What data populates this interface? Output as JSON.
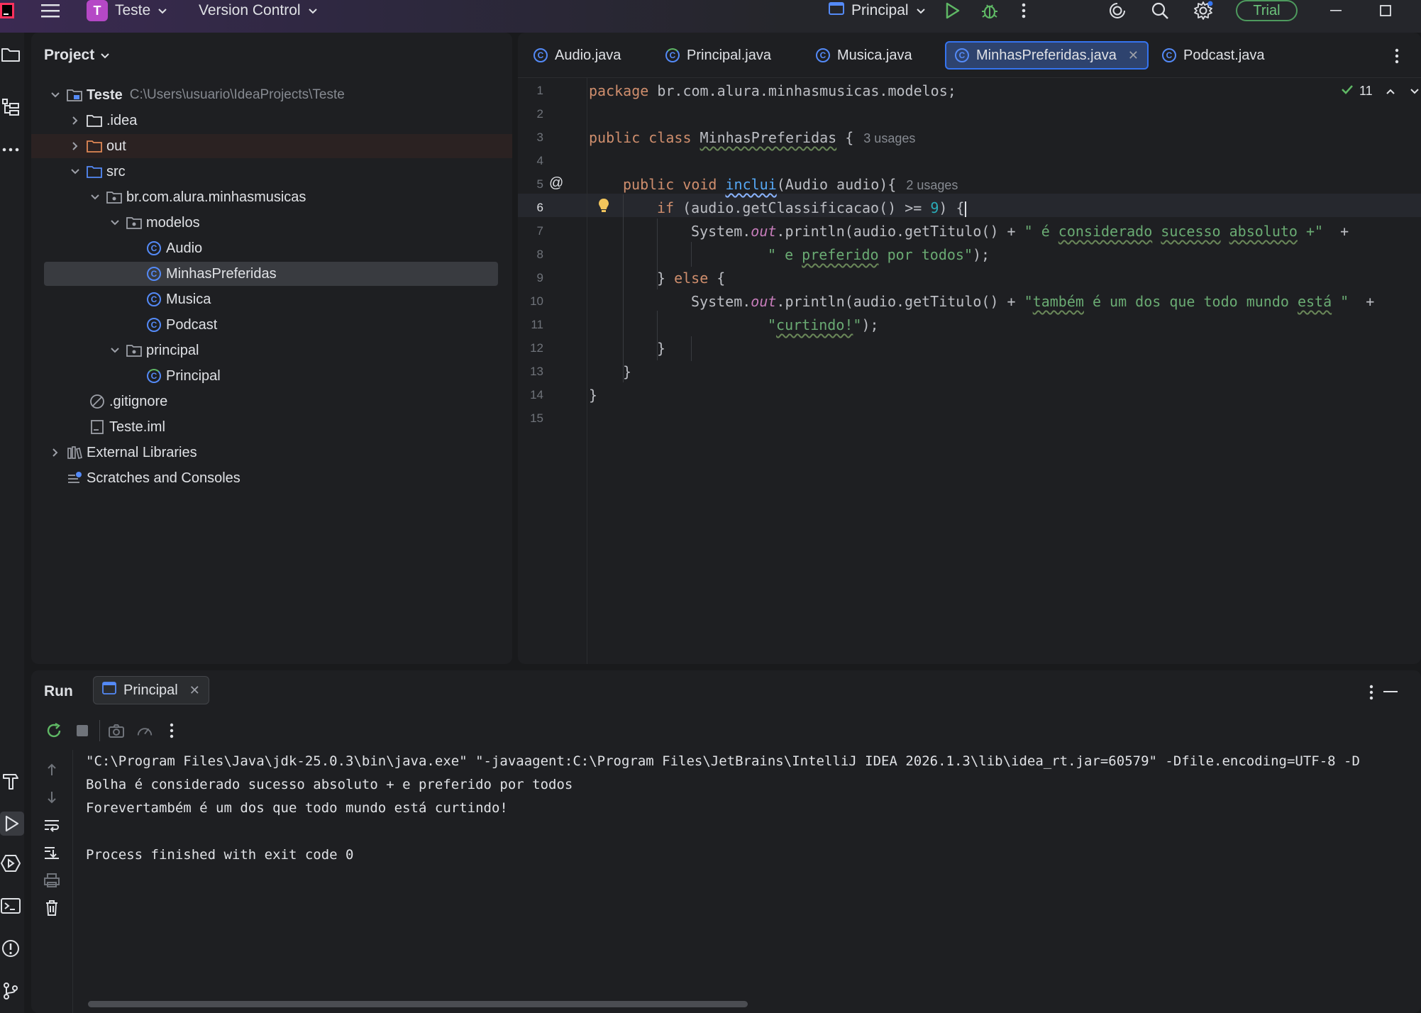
{
  "titlebar": {
    "project_badge": "T",
    "project_name": "Teste",
    "version_control": "Version Control",
    "run_config": "Principal",
    "trial": "Trial"
  },
  "project_panel": {
    "title": "Project",
    "tree": [
      {
        "label": "Teste",
        "path": "C:\\Users\\usuario\\IdeaProjects\\Teste"
      },
      {
        "label": ".idea"
      },
      {
        "label": "out"
      },
      {
        "label": "src"
      },
      {
        "label": "br.com.alura.minhasmusicas"
      },
      {
        "label": "modelos"
      },
      {
        "label": "Audio"
      },
      {
        "label": "MinhasPreferidas"
      },
      {
        "label": "Musica"
      },
      {
        "label": "Podcast"
      },
      {
        "label": "principal"
      },
      {
        "label": "Principal"
      },
      {
        "label": ".gitignore"
      },
      {
        "label": "Teste.iml"
      },
      {
        "label": "External Libraries"
      },
      {
        "label": "Scratches and Consoles"
      }
    ]
  },
  "editor": {
    "tabs": [
      {
        "label": "Audio.java"
      },
      {
        "label": "Principal.java"
      },
      {
        "label": "Musica.java"
      },
      {
        "label": "MinhasPreferidas.java"
      },
      {
        "label": "Podcast.java"
      }
    ],
    "inspection_count": "11",
    "line_numbers": [
      "1",
      "2",
      "3",
      "4",
      "5",
      "6",
      "7",
      "8",
      "9",
      "10",
      "11",
      "12",
      "13",
      "14",
      "15"
    ],
    "code": {
      "l1_kw": "package",
      "l1_rest": " br.com.alura.minhasmusicas.modelos;",
      "l3_kw": "public class ",
      "l3_name": "MinhasPreferidas",
      "l3_rest": " {",
      "l3_hint": "3 usages",
      "l5_kw": "public void ",
      "l5_fn": "inclui",
      "l5_rest": "(Audio audio){",
      "l5_hint": "2 usages",
      "l6_kw": "if",
      "l6_a": " (audio.getClassificacao() >= ",
      "l6_num": "9",
      "l6_b": ") {",
      "l7_a": "System.",
      "l7_out": "out",
      "l7_b": ".println(audio.getTitulo() + ",
      "l7_s1": "\" é ",
      "l7_w1": "considerado",
      "l7_sp1": " ",
      "l7_w2": "sucesso",
      "l7_sp2": " ",
      "l7_w3": "absoluto",
      "l7_s2": " +\"",
      "l7_c": "  +",
      "l8_s1": "\" e ",
      "l8_w1": "preferido",
      "l8_s2": " por todos\"",
      "l8_c": ");",
      "l9_a": "} ",
      "l9_kw": "else",
      "l9_b": " {",
      "l10_a": "System.",
      "l10_out": "out",
      "l10_b": ".println(audio.getTitulo() + ",
      "l10_s1": "\"",
      "l10_w1": "também",
      "l10_s2": " é um dos que todo mundo ",
      "l10_w2": "está",
      "l10_s3": " \"",
      "l10_c": "  +",
      "l11_s1": "\"",
      "l11_w1": "curtindo!",
      "l11_s2": "\"",
      "l11_c": ");",
      "l12": "}",
      "l13": "}",
      "l14": "}"
    }
  },
  "run_panel": {
    "title": "Run",
    "tab": "Principal",
    "console": [
      "\"C:\\Program Files\\Java\\jdk-25.0.3\\bin\\java.exe\" \"-javaagent:C:\\Program Files\\JetBrains\\IntelliJ IDEA 2026.1.3\\lib\\idea_rt.jar=60579\" -Dfile.encoding=UTF-8 -D",
      "Bolha é considerado sucesso absoluto + e preferido por todos",
      "Forevertambém é um dos que todo mundo está curtindo!",
      "",
      "Process finished with exit code 0"
    ]
  }
}
